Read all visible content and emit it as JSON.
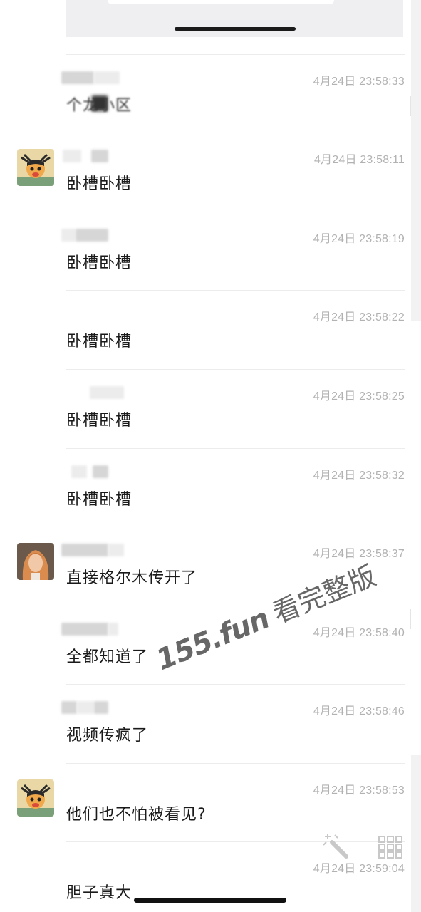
{
  "messages": [
    {
      "time": "4月24日 23:58:33",
      "text": "个龙小区",
      "avatar": "none",
      "garbled": true
    },
    {
      "time": "4月24日 23:58:11",
      "text": "卧槽卧槽",
      "avatar": "cartoon"
    },
    {
      "time": "4月24日 23:58:19",
      "text": "卧槽卧槽",
      "avatar": "none"
    },
    {
      "time": "4月24日 23:58:22",
      "text": "卧槽卧槽",
      "avatar": "none"
    },
    {
      "time": "4月24日 23:58:25",
      "text": "卧槽卧槽",
      "avatar": "none"
    },
    {
      "time": "4月24日 23:58:32",
      "text": "卧槽卧槽",
      "avatar": "none"
    },
    {
      "time": "4月24日 23:58:37",
      "text": "直接格尔木传开了",
      "avatar": "photo"
    },
    {
      "time": "4月24日 23:58:40",
      "text": "全都知道了",
      "avatar": "none"
    },
    {
      "time": "4月24日 23:58:46",
      "text": "视频传疯了",
      "avatar": "none"
    },
    {
      "time": "4月24日 23:58:53",
      "text": "他们也不怕被看见?",
      "avatar": "cartoon"
    },
    {
      "time": "4月24日 23:59:04",
      "text": "胆子真大",
      "avatar": "none"
    }
  ],
  "watermark": {
    "domain": "155.fun",
    "cta": "看完整版"
  },
  "icons": {
    "magic": "magic-wand-icon",
    "grid": "grid-icon"
  },
  "colors": {
    "background": "#ffffff",
    "timestamp": "#b2b2b2",
    "message_text": "#1a1a1a",
    "separator": "#ececec"
  }
}
